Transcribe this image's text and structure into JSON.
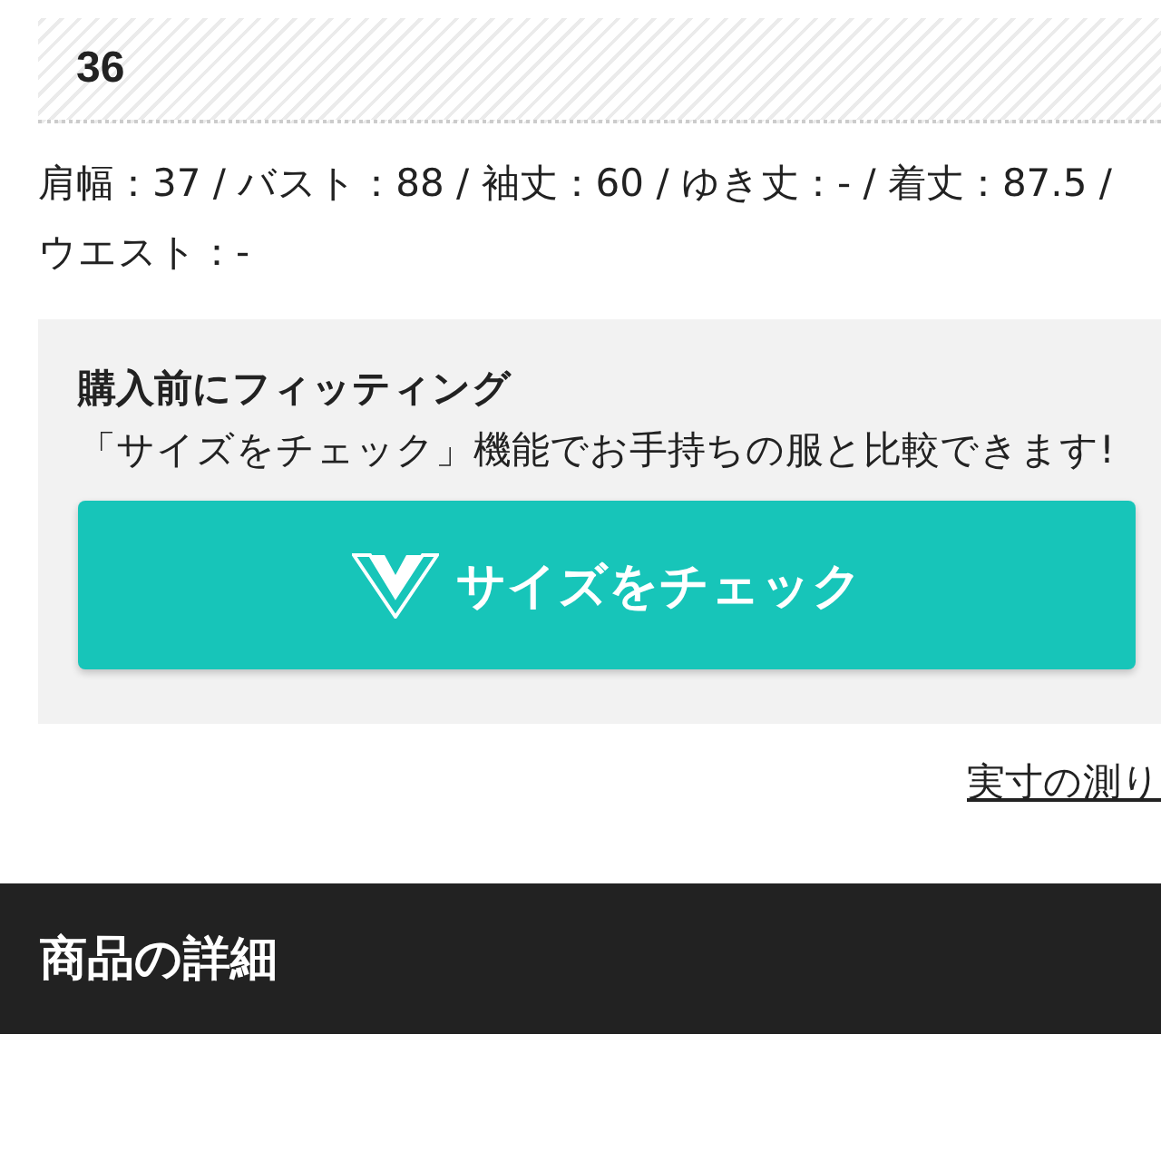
{
  "size": {
    "label": "36"
  },
  "measurements": "肩幅：37 / バスト：88 / 袖丈：60 / ゆき丈：- / 着丈：87.5 / ウエスト：-",
  "fitting": {
    "title": "購入前にフィッティング",
    "description": "「サイズをチェック」機能でお手持ちの服と比較できます!",
    "button": "サイズをチェック"
  },
  "measure_link": "実寸の測り",
  "section_header": "商品の詳細"
}
